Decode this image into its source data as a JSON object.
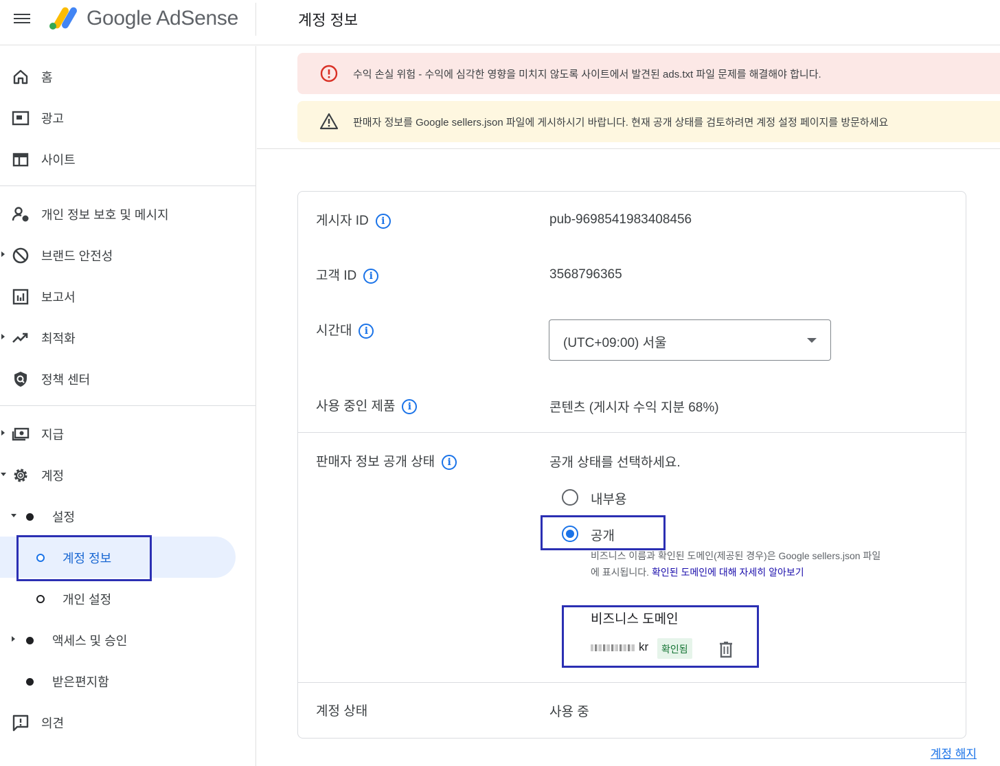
{
  "app": {
    "brand": "Google AdSense",
    "page_title": "계정 정보"
  },
  "sidebar": {
    "items": [
      {
        "label": "홈",
        "icon": "home-icon"
      },
      {
        "label": "광고",
        "icon": "ads-icon"
      },
      {
        "label": "사이트",
        "icon": "sites-icon"
      },
      {
        "label": "개인 정보 보호 및 메시지",
        "icon": "privacy-icon"
      },
      {
        "label": "브랜드 안전성",
        "icon": "block-icon"
      },
      {
        "label": "보고서",
        "icon": "reports-icon"
      },
      {
        "label": "최적화",
        "icon": "trending-icon"
      },
      {
        "label": "정책 센터",
        "icon": "policy-shield-icon"
      },
      {
        "label": "지급",
        "icon": "payments-icon"
      },
      {
        "label": "계정",
        "icon": "gear-icon"
      }
    ],
    "sub": {
      "settings": "설정",
      "account_info": "계정 정보",
      "personal_settings": "개인 설정",
      "access": "액세스 및 승인",
      "inbox": "받은편지함"
    },
    "feedback": "의견"
  },
  "alerts": {
    "error": "수익 손실 위험 - 수익에 심각한 영향을 미치지 않도록 사이트에서 발견된 ads.txt 파일 문제를 해결해야 합니다.",
    "warning": "판매자 정보를 Google sellers.json 파일에 게시하시기 바랍니다. 현재 공개 상태를 검토하려면 계정 설정 페이지를 방문하세요"
  },
  "account": {
    "publisher_id_label": "게시자 ID",
    "publisher_id": "pub-9698541983408456",
    "customer_id_label": "고객 ID",
    "customer_id": "3568796365",
    "timezone_label": "시간대",
    "timezone_value": "(UTC+09:00) 서울",
    "products_label": "사용 중인 제품",
    "products_value": "콘텐츠 (게시자 수익 지분 68%)",
    "seller_label": "판매자 정보 공개 상태",
    "seller_prompt": "공개 상태를 선택하세요.",
    "option_internal": "내부용",
    "option_public": "공개",
    "selected_option": "공개",
    "help_line1": "비즈니스 이름과 확인된 도메인(제공된 경우)은 Google sellers.json 파일",
    "help_line2_prefix": "에 표시됩니다. ",
    "help_link": "확인된 도메인에 대해 자세히 알아보기",
    "business_domain_label": "비즈니스 도메인",
    "domain_suffix": "kr",
    "domain_status": "확인됨",
    "status_label": "계정 상태",
    "status_value": "사용 중",
    "cancel_link": "계정 해지"
  },
  "colors": {
    "accent": "#1a73e8",
    "highlight_box": "#2b2fb3",
    "error_bg": "#fce8e6",
    "warning_bg": "#fef7e0",
    "active_bg": "#e8f0fe",
    "verified_bg": "#e6f4ea"
  }
}
